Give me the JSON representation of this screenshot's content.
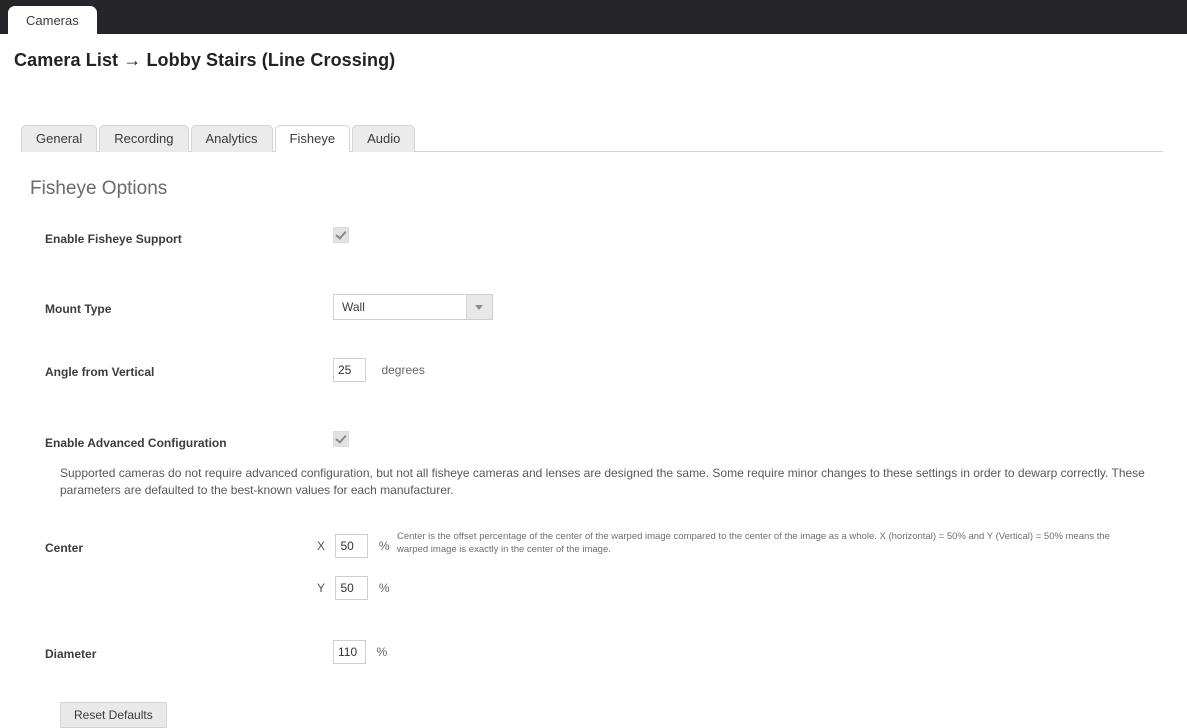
{
  "window": {
    "app_tab_label": "Cameras"
  },
  "breadcrumb": {
    "root": "Camera List",
    "separator": "→",
    "current": "Lobby Stairs (Line Crossing)",
    "full": "Camera List → Lobby Stairs (Line Crossing)"
  },
  "tabs": [
    {
      "label": "General",
      "active": false
    },
    {
      "label": "Recording",
      "active": false
    },
    {
      "label": "Analytics",
      "active": false
    },
    {
      "label": "Fisheye",
      "active": true
    },
    {
      "label": "Audio",
      "active": false
    }
  ],
  "section": {
    "title": "Fisheye Options"
  },
  "fields": {
    "enable_fisheye": {
      "label": "Enable Fisheye Support",
      "checked": true
    },
    "mount_type": {
      "label": "Mount Type",
      "value": "Wall"
    },
    "angle_from_vertical": {
      "label": "Angle from Vertical",
      "value": "25",
      "unit": "degrees"
    },
    "enable_advanced": {
      "label": "Enable Advanced Configuration",
      "checked": true,
      "description": "Supported cameras do not require advanced configuration, but not all fisheye cameras and lenses are designed the same. Some require minor changes to these settings in order to dewarp correctly. These parameters are defaulted to the best-known values for each manufacturer."
    },
    "center": {
      "label": "Center",
      "x_prefix": "X",
      "x_value": "50",
      "x_unit": "%",
      "y_prefix": "Y",
      "y_value": "50",
      "y_unit": "%",
      "help": "Center is the offset percentage of the center of the warped image compared to the center of the image as a whole. X (horizontal) = 50% and Y (Vertical) = 50% means the warped image is exactly in the center of the image."
    },
    "diameter": {
      "label": "Diameter",
      "value": "110",
      "unit": "%"
    }
  },
  "actions": {
    "reset_defaults": "Reset Defaults"
  },
  "colors": {
    "topbar": "#26262a",
    "active_tab_bg": "#ffffff",
    "inactive_tab_bg": "#ebebeb",
    "heading": "#6a6a6a",
    "button_bg": "#e9e9e9"
  }
}
